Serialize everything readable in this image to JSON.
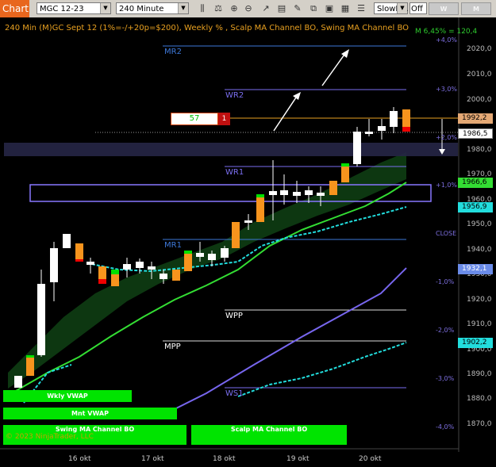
{
  "toolbar": {
    "tab_label": "Chart",
    "instrument": "MGC 12-23",
    "interval": "240 Minute",
    "indicator_select": "SlowMA",
    "toggle_select": "Off",
    "w_vwap": "W VWAP",
    "m_vwap": "M VWAP"
  },
  "chart": {
    "title": "240 Min (M)GC Sept 12 (1%=-/+20p=$200), Weekly % , Scalp MA Channel BO, Swing MA Channel BO",
    "mfe": "M 6,45% = 120,4",
    "copyright": "© 2023 NinjaTrader, LLC",
    "order_qty_field": "57",
    "order_count": "1",
    "price_axis": [
      "2020,0",
      "2010,0",
      "2000,0",
      "1980,0",
      "1970,0",
      "1960,0",
      "1950,0",
      "1940,0",
      "1930,0",
      "1920,0",
      "1910,0",
      "1900,0",
      "1890,0",
      "1880,0",
      "1870,0"
    ],
    "pct_axis": [
      "+4,0%",
      "+3,0%",
      "+2,0%",
      "+1,0%",
      "CLOSE",
      "-1,0%",
      "-2,0%",
      "-3,0%",
      "-4,0%"
    ],
    "dates": [
      "16 okt",
      "17 okt",
      "18 okt",
      "19 okt",
      "20 okt"
    ],
    "levels": {
      "mr2": "MR2",
      "wr2": "WR2",
      "wr1": "WR1",
      "mr1": "MR1",
      "wpp": "WPP",
      "mpp": "MPP",
      "ws1": "WS1"
    },
    "tags": {
      "ask": "1992,2",
      "last": "1986,5",
      "scalp_ma": "1966,6",
      "vwap_upper": "1956,9",
      "swing_ma": "1932,1",
      "vwap_lower": "1902,2"
    },
    "boxes": {
      "wkly_vwap": "Wkly VWAP",
      "mnt_vwap": "Mnt VWAP",
      "swing_ma": "Swing MA Channel BO",
      "scalp_ma": "Scalp MA Channel BO"
    }
  },
  "colors": {
    "accent": "#e8661e",
    "up_candle": "#ffffff",
    "down_candle": "#f7941d",
    "swing_line": "#33dd33",
    "vwap": "#22dddd",
    "monthly_line": "#7766ee"
  }
}
